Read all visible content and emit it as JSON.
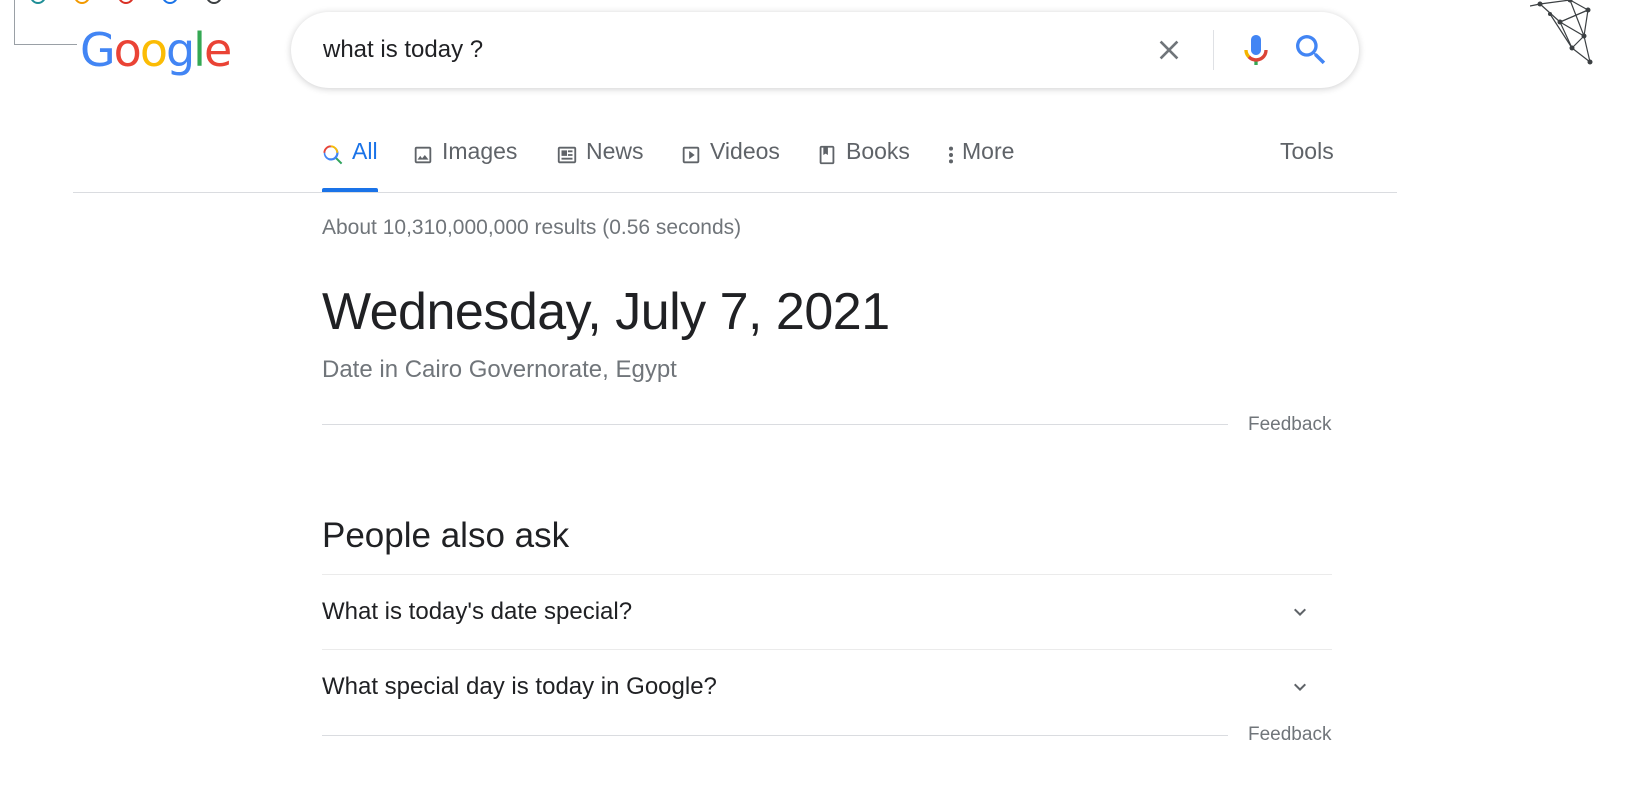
{
  "logo": {
    "letters": [
      "G",
      "o",
      "o",
      "g",
      "l",
      "e"
    ],
    "colors": [
      "#4285F4",
      "#EA4335",
      "#FBBC05",
      "#4285F4",
      "#34A853",
      "#EA4335"
    ]
  },
  "search": {
    "query": "what is today ?",
    "clear_icon": "close-icon",
    "mic_icon": "mic-icon",
    "search_icon": "search-icon"
  },
  "tabs": [
    {
      "label": "All",
      "icon": "search-icon",
      "active": true
    },
    {
      "label": "Images",
      "icon": "image-icon"
    },
    {
      "label": "News",
      "icon": "news-icon"
    },
    {
      "label": "Videos",
      "icon": "play-icon"
    },
    {
      "label": "Books",
      "icon": "book-icon"
    },
    {
      "label": "More",
      "icon": "more-vert-icon"
    }
  ],
  "tools_label": "Tools",
  "result_stats": "About 10,310,000,000 results (0.56 seconds)",
  "date_card": {
    "date": "Wednesday, July 7, 2021",
    "location": "Date in Cairo Governorate, Egypt",
    "feedback": "Feedback"
  },
  "people_also_ask": {
    "title": "People also ask",
    "questions": [
      "What is today's date special?",
      "What special day is today in Google?"
    ],
    "feedback": "Feedback"
  },
  "colors": {
    "accent": "#1a73e8",
    "muted_text": "#70757a",
    "tab_text": "#5f6368",
    "divider": "#dadce0"
  }
}
